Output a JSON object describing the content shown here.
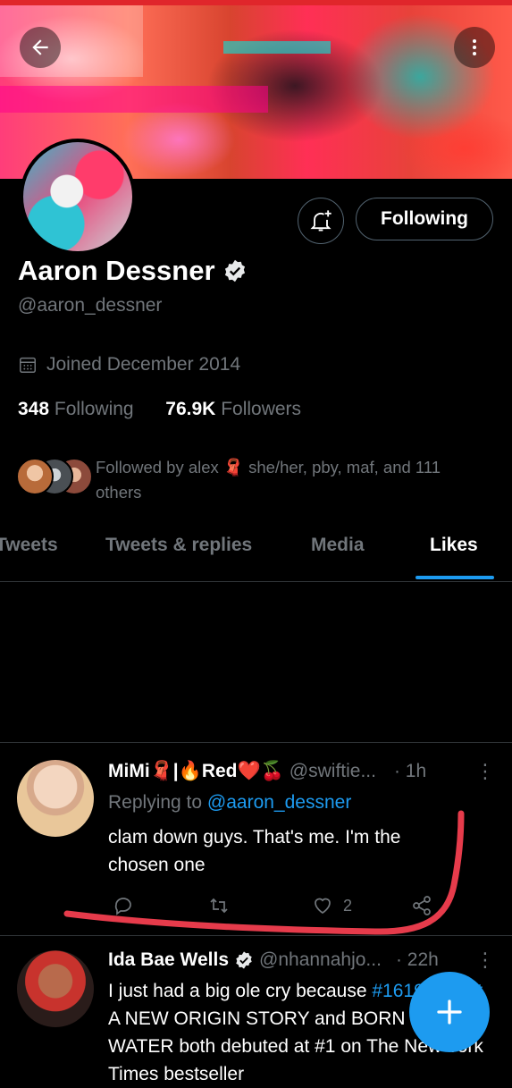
{
  "colors": {
    "accent": "#1d9bf0",
    "annotation": "#e63b4b",
    "verified": "#e7e9ea"
  },
  "header": {
    "back_icon": "arrow-left-icon",
    "more_icon": "more-vertical-icon"
  },
  "profile": {
    "name": "Aaron Dessner",
    "handle": "@aaron_dessner",
    "joined": "Joined December 2014",
    "following_count": "348",
    "following_label": "Following",
    "followers_count": "76.9K",
    "followers_label": "Followers",
    "followed_by": "Followed by alex 🧣 she/her, pby, maf, and 111 others",
    "follow_button": "Following"
  },
  "tabs": [
    "Tweets",
    "Tweets & replies",
    "Media",
    "Likes"
  ],
  "active_tab": "Likes",
  "tweets": [
    {
      "display_name": "MiMi🧣|🔥Red❤️🍒",
      "handle": "@swiftie...",
      "time": "· 1h",
      "reply_prefix": "Replying to",
      "reply_handle": "@aaron_dessner",
      "text": "clam down guys. That's me. I'm the chosen one",
      "like_count": "2"
    },
    {
      "display_name": "Ida Bae Wells",
      "handle": "@nhannahjo...",
      "time": "· 22h",
      "text_prefix": "I just had a big ole cry because",
      "hashtag": "#1619Project",
      "text_rest": "A NEW ORIGIN STORY and BORN ON THE WATER both debuted at #1 on The New York Times bestseller"
    }
  ]
}
